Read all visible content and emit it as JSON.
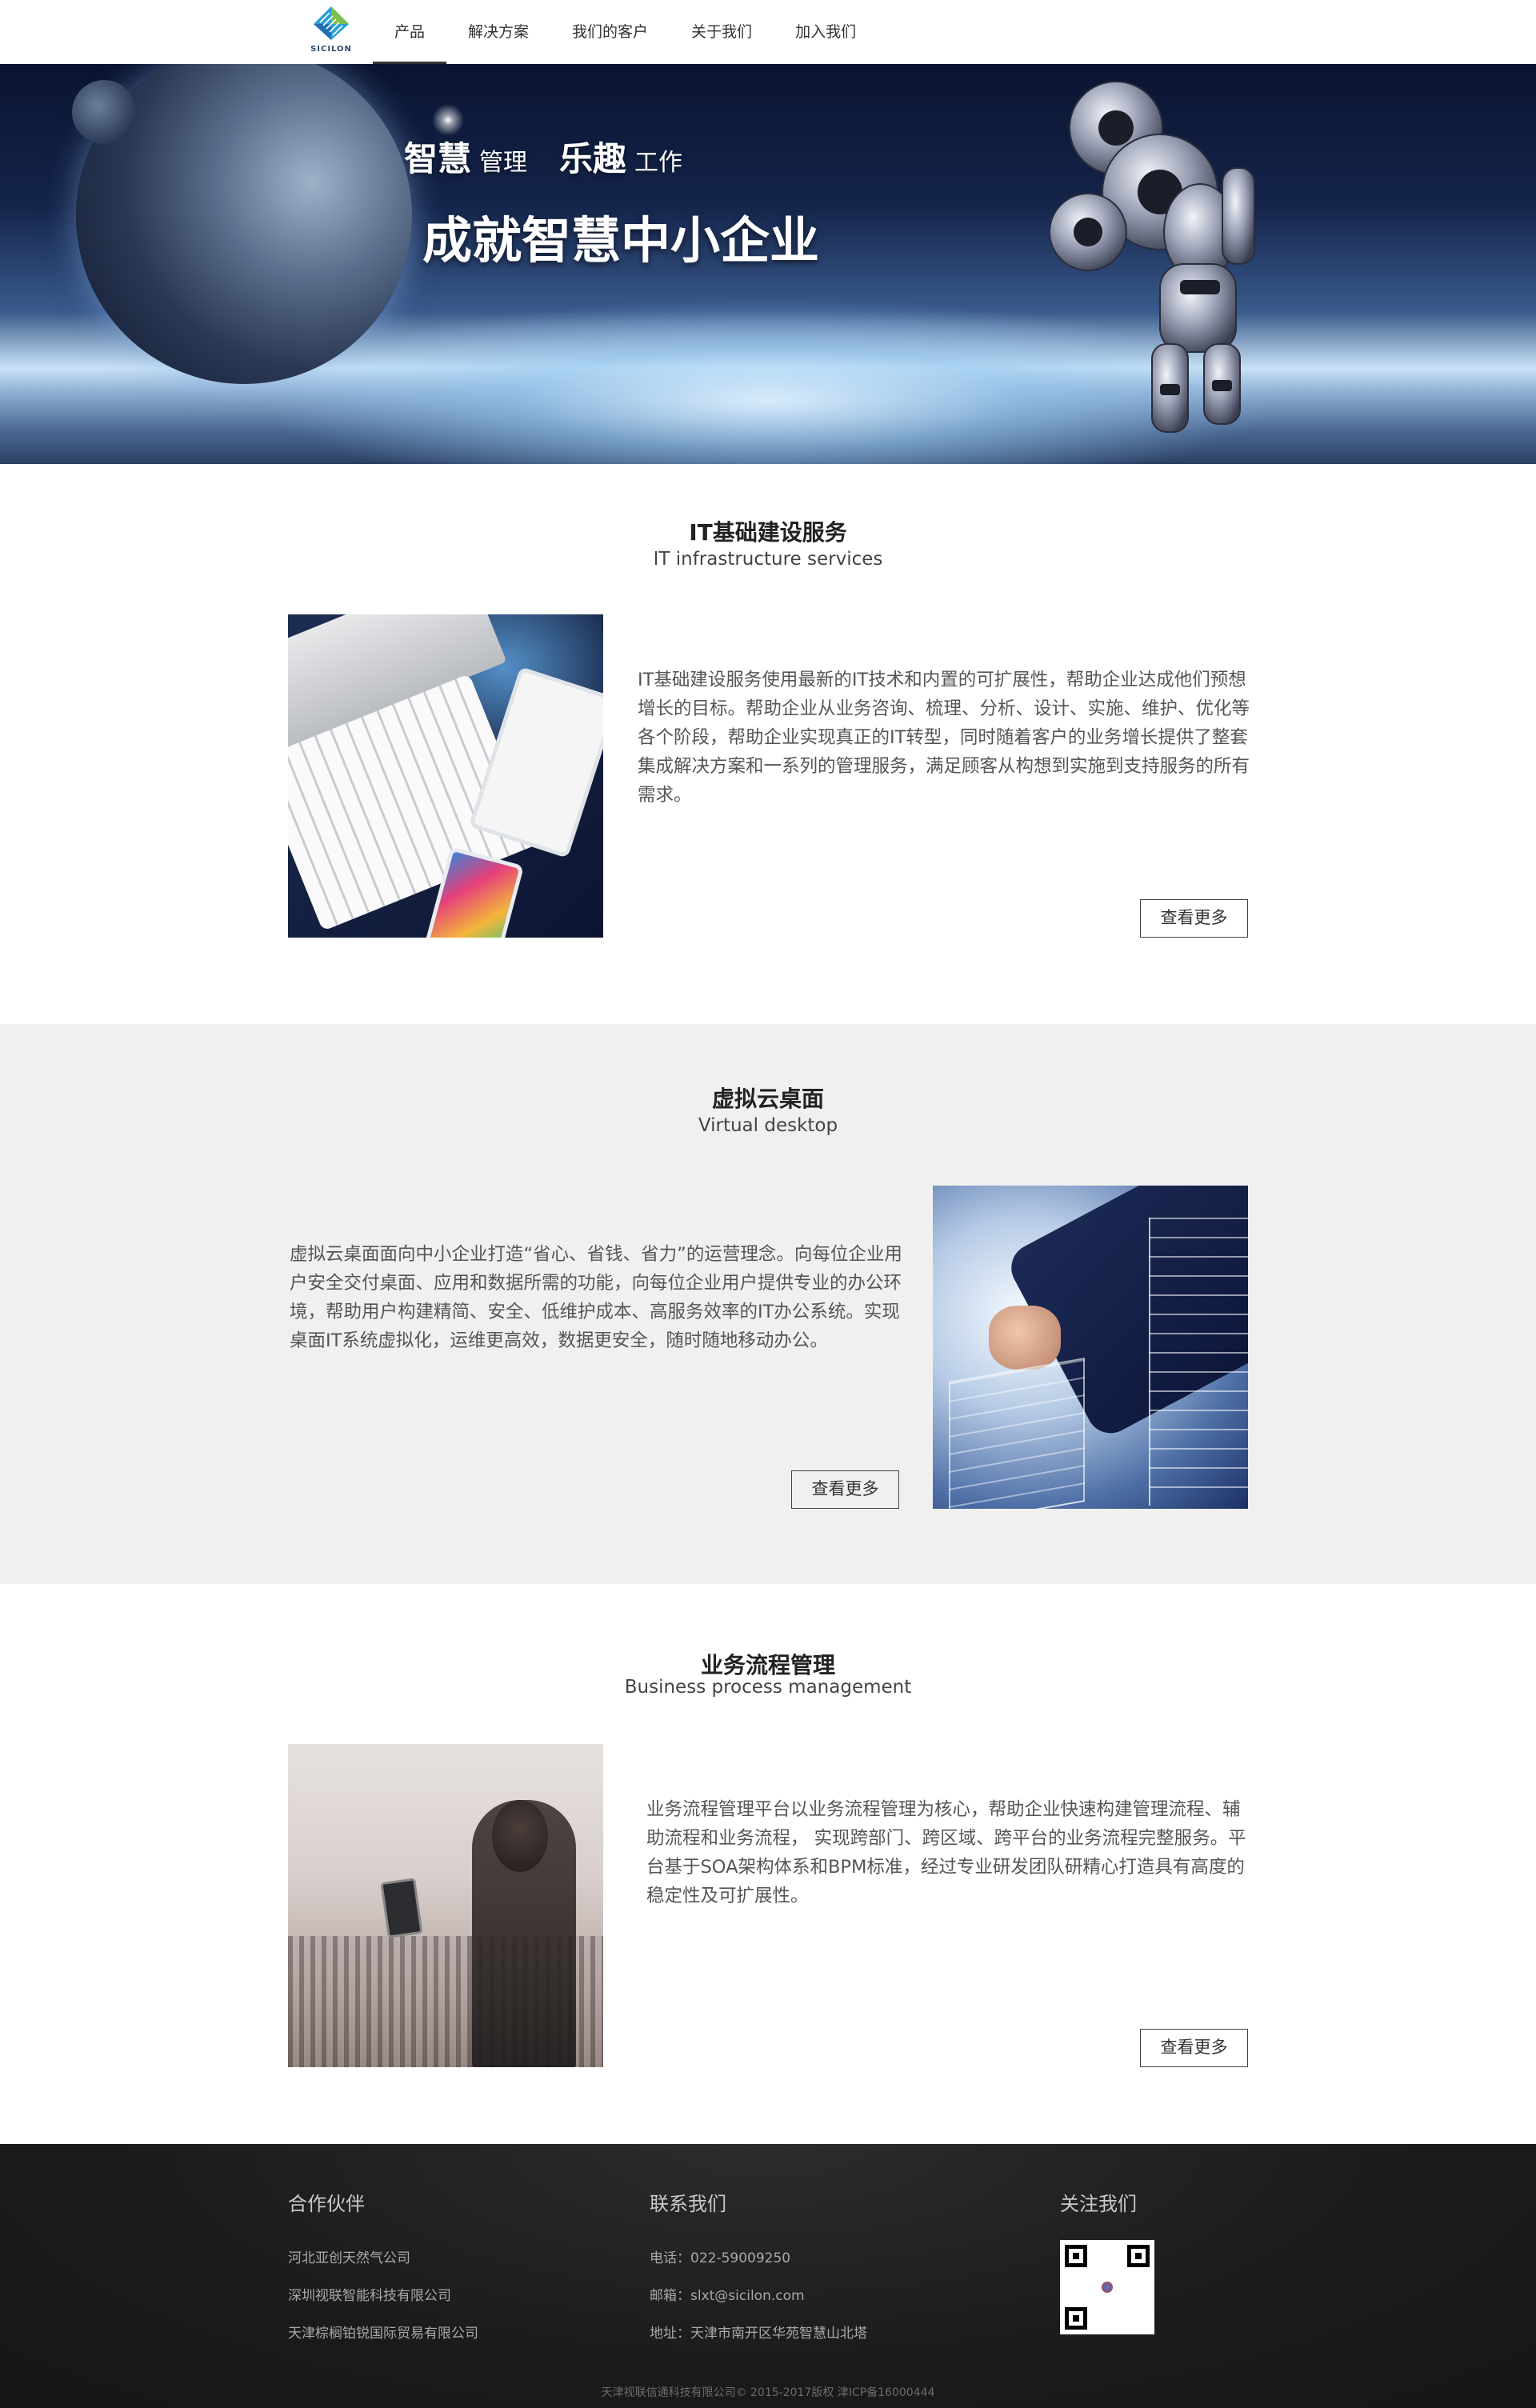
{
  "nav": {
    "logo_text": "SICILON",
    "items": [
      {
        "label": "产品"
      },
      {
        "label": "解决方案"
      },
      {
        "label": "我们的客户"
      },
      {
        "label": "关于我们"
      },
      {
        "label": "加入我们"
      }
    ],
    "active_index": 0
  },
  "hero": {
    "word1_big": "智慧",
    "word1_small": "管理",
    "word2_big": "乐趣",
    "word2_small": "工作",
    "title": "成就智慧中小企业"
  },
  "sections": [
    {
      "title": "IT基础建设服务",
      "subtitle": "IT infrastructure services",
      "text": "IT基础建设服务使用最新的IT技术和内置的可扩展性，帮助企业达成他们预想增长的目标。帮助企业从业务咨询、梳理、分析、设计、实施、维护、优化等各个阶段，帮助企业实现真正的IT转型，同时随着客户的业务增长提供了整套集成解决方案和一系列的管理服务，满足顾客从构想到实施到支持服务的所有需求。",
      "button": "查看更多"
    },
    {
      "title": "虚拟云桌面",
      "subtitle": "Virtual desktop",
      "text": "虚拟云桌面面向中小企业打造“省心、省钱、省力”的运营理念。向每位企业用户安全交付桌面、应用和数据所需的功能，向每位企业用户提供专业的办公环境，帮助用户构建精简、安全、低维护成本、高服务效率的IT办公系统。实现桌面IT系统虚拟化，运维更高效，数据更安全，随时随地移动办公。",
      "button": "查看更多"
    },
    {
      "title": "业务流程管理",
      "subtitle": "Business process management",
      "text": "业务流程管理平台以业务流程管理为核心，帮助企业快速构建管理流程、辅助流程和业务流程， 实现跨部门、跨区域、跨平台的业务流程完整服务。平台基于SOA架构体系和BPM标准，经过专业研发团队研精心打造具有高度的稳定性及可扩展性。",
      "button": "查看更多"
    }
  ],
  "footer": {
    "partners": {
      "title": "合作伙伴",
      "items": [
        "河北亚创天然气公司",
        "深圳视联智能科技有限公司",
        "天津棕榈铂锐国际贸易有限公司"
      ]
    },
    "contact": {
      "title": "联系我们",
      "items": [
        "电话：022-59009250",
        "邮箱：slxt@sicilon.com",
        "地址：天津市南开区华苑智慧山北塔"
      ]
    },
    "follow": {
      "title": "关注我们"
    },
    "copyright": "天津视联信通科技有限公司© 2015-2017版权 津ICP备16000444"
  }
}
